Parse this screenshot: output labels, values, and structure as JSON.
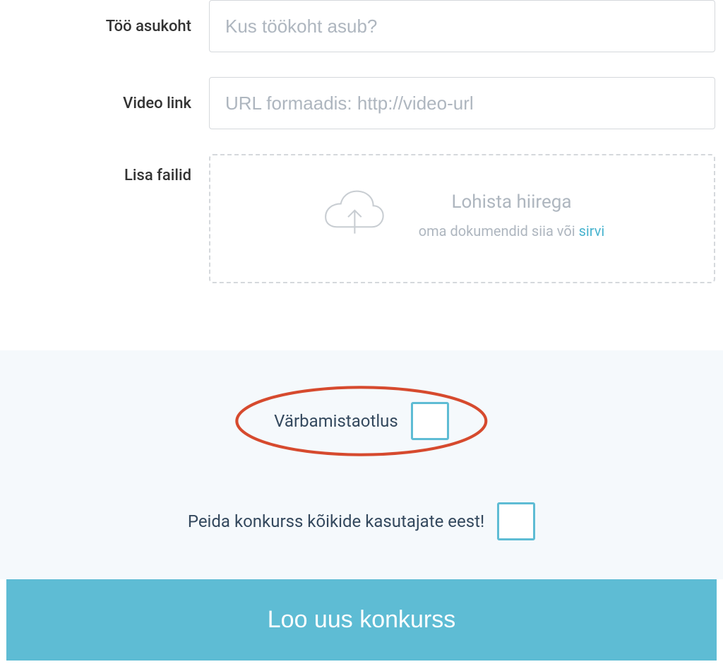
{
  "form": {
    "location": {
      "label": "Töö asukoht",
      "placeholder": "Kus töökoht asub?"
    },
    "video": {
      "label": "Video link",
      "placeholder": "URL formaadis: http://video-url"
    },
    "files": {
      "label": "Lisa failid",
      "drop_title": "Lohista hiirega",
      "drop_subtitle_prefix": "oma dokumendid siia või ",
      "browse": "sirvi"
    }
  },
  "options": {
    "recruitment_request_label": "Värbamistaotlus",
    "hide_competition_label": "Peida konkurss kõikide kasutajate eest!"
  },
  "submit_label": "Loo uus konkurss"
}
